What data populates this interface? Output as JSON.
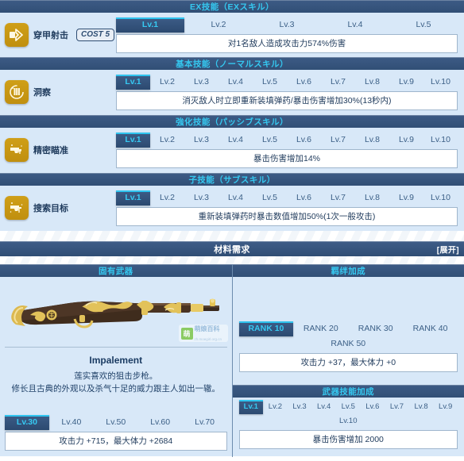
{
  "sections": {
    "ex": "EX技能（EXスキル）",
    "normal": "基本技能（ノーマルスキル）",
    "passive": "強化技能（パッシブスキル）",
    "sub": "子技能（サブスキル）",
    "material": "材料需求",
    "material_toggle": "[展开]",
    "unique_weapon": "固有武器",
    "bond_bonus": "羁绊加成",
    "weapon_skill_bonus": "武器技能加成"
  },
  "skills": [
    {
      "id": "ex",
      "icon": "armor-piercing-shot-icon",
      "name": "穿甲射击",
      "cost": "COST 5",
      "levels": [
        "Lv.1",
        "Lv.2",
        "Lv.3",
        "Lv.4",
        "Lv.5"
      ],
      "active_level": "Lv.1",
      "description": "对1名敌人造成攻击力574%伤害"
    },
    {
      "id": "normal",
      "icon": "insight-icon",
      "name": "洞察",
      "cost": "",
      "levels": [
        "Lv.1",
        "Lv.2",
        "Lv.3",
        "Lv.4",
        "Lv.5",
        "Lv.6",
        "Lv.7",
        "Lv.8",
        "Lv.9",
        "Lv.10"
      ],
      "active_level": "Lv.1",
      "description": "消灭敌人时立即重新装填弹药/暴击伤害增加30%(13秒内)"
    },
    {
      "id": "passive",
      "icon": "precision-aim-icon",
      "name": "精密瞄准",
      "cost": "",
      "levels": [
        "Lv.1",
        "Lv.2",
        "Lv.3",
        "Lv.4",
        "Lv.5",
        "Lv.6",
        "Lv.7",
        "Lv.8",
        "Lv.9",
        "Lv.10"
      ],
      "active_level": "Lv.1",
      "description": "暴击伤害增加14%"
    },
    {
      "id": "sub",
      "icon": "search-target-icon",
      "name": "搜索目标",
      "cost": "",
      "levels": [
        "Lv.1",
        "Lv.2",
        "Lv.3",
        "Lv.4",
        "Lv.5",
        "Lv.6",
        "Lv.7",
        "Lv.8",
        "Lv.9",
        "Lv.10"
      ],
      "active_level": "Lv.1",
      "description": "重新装填弹药时暴击数值增加50%(1次一般攻击)"
    }
  ],
  "weapon": {
    "name": "Impalement",
    "desc_line1": "莲实喜欢的狙击步枪。",
    "desc_line2": "修长且古典的外观以及杀气十足的威力跟主人如出一辙。",
    "levels": [
      "Lv.30",
      "Lv.40",
      "Lv.50",
      "Lv.60",
      "Lv.70"
    ],
    "active_level": "Lv.30",
    "stats": "攻击力 +715，最大体力 +2684",
    "watermark_badge": "萌",
    "watermark_title": "萌娘百科",
    "watermark_sub": "zh.moegirl.org.cn"
  },
  "bond": {
    "ranks": [
      "RANK 10",
      "RANK 20",
      "RANK 30",
      "RANK 40",
      "RANK 50"
    ],
    "active_rank": "RANK 10",
    "stats": "攻击力 +37，最大体力 +0"
  },
  "weapon_skill": {
    "levels": [
      "Lv.1",
      "Lv.2",
      "Lv.3",
      "Lv.4",
      "Lv.5",
      "Lv.6",
      "Lv.7",
      "Lv.8",
      "Lv.9",
      "Lv.10"
    ],
    "active_level": "Lv.1",
    "description": "暴击伤害增加 2000"
  },
  "colors": {
    "bar": "#39567f",
    "accent": "#2ec4ef",
    "panel": "#d8e8f8",
    "icon_gold": "#cf9f18"
  }
}
